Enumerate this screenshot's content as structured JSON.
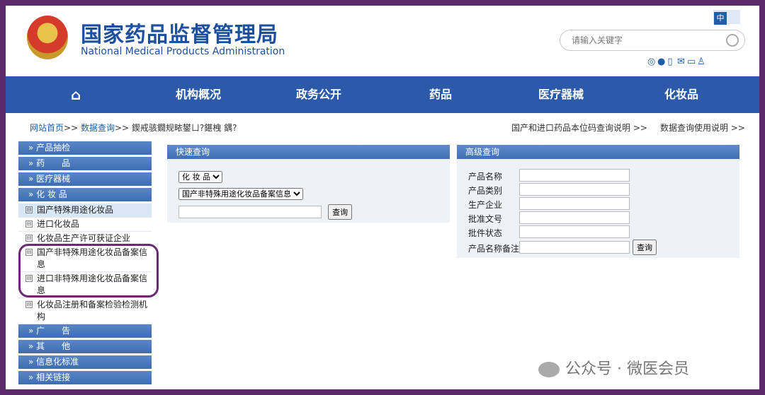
{
  "header": {
    "title_cn": "国家药品监督管理局",
    "title_en": "National Medical Products Administration",
    "lang": "中",
    "search_placeholder": "请输入关键字"
  },
  "nav": [
    "机构概况",
    "政务公开",
    "药品",
    "医疗器械",
    "化妆品"
  ],
  "breadcrumb": {
    "home": "网站首页",
    "sep": ">>",
    "query": "数据查询",
    "current": "鍥戒骇鐗规畩鐢ㄩ?鍖栧 鍝?",
    "links": [
      "国产和进口药品本位码查询说明 >>",
      "数据查询使用说明 >>"
    ]
  },
  "sidebar": {
    "cats_top": [
      "» 产品抽检",
      "» 药　　品",
      "» 医疗器械",
      "» 化 妆 品"
    ],
    "subs": [
      "国产特殊用途化妆品",
      "进口化妆品",
      "化妆品生产许可获证企业",
      "国产非特殊用途化妆品备案信息",
      "进口非特殊用途化妆品备案信息",
      "化妆品注册和备案检验检测机构"
    ],
    "cats_bottom": [
      "» 广　　告",
      "» 其　　他",
      "» 信息化标准",
      "» 相关链接"
    ],
    "pm": "⊟"
  },
  "quick": {
    "title": "快速查询",
    "select1": "化 妆 品",
    "select2": "国产非特殊用途化妆品备案信息",
    "button": "查询"
  },
  "advanced": {
    "title": "高级查询",
    "fields": [
      "产品名称",
      "产品类别",
      "生产企业",
      "批准文号",
      "批件状态",
      "产品名称备注"
    ],
    "button": "查询"
  },
  "watermark": "公众号 · 微医会员",
  "colors": {
    "nav": "#2c5aa8",
    "title": "#1d4f9f",
    "highlight": "#6b2a74"
  }
}
